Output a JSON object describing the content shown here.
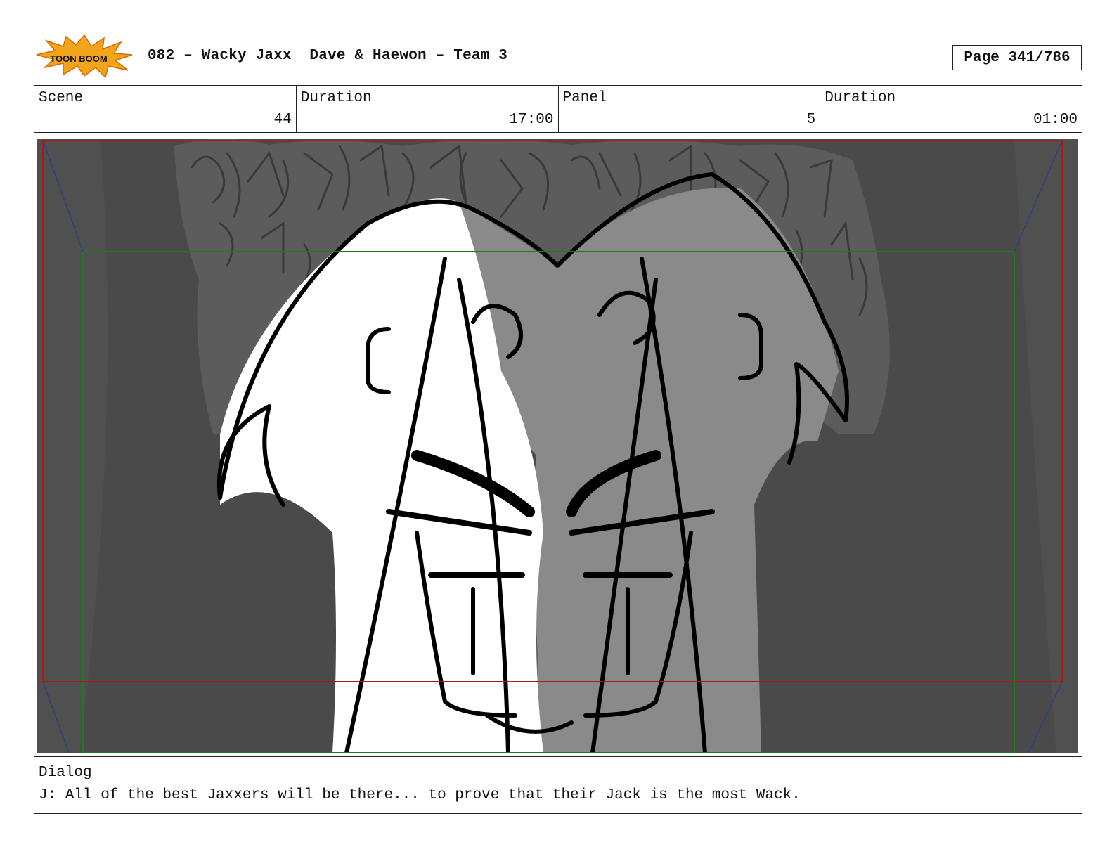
{
  "header": {
    "logo_text": "TOON BOOM",
    "title": "082 – Wacky Jaxx  Dave & Haewon – Team 3",
    "page": "Page 341/786"
  },
  "info": {
    "scene_label": "Scene",
    "scene_value": "44",
    "scene_duration_label": "Duration",
    "scene_duration_value": "17:00",
    "panel_label": "Panel",
    "panel_value": "5",
    "panel_duration_label": "Duration",
    "panel_duration_value": "01:00"
  },
  "panel_image": {
    "icon": "storyboard-sketch",
    "colors": {
      "background": "#4a4a4a",
      "crowd": "#5a5a5a",
      "shadow": "#8a8a8a",
      "safe_frame": "#1e7a1e",
      "action_frame": "#b01818"
    }
  },
  "dialog": {
    "label": "Dialog",
    "text": "J: All of the best Jaxxers will be there... to prove that their Jack is the most Wack."
  }
}
